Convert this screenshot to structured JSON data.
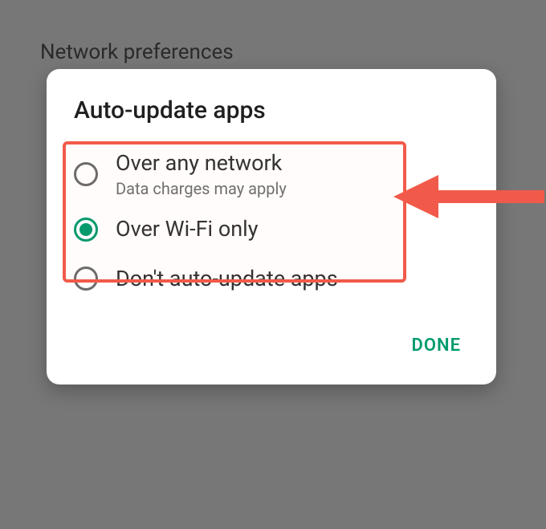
{
  "background": {
    "header": "Network preferences"
  },
  "dialog": {
    "title": "Auto-update apps",
    "options": [
      {
        "label": "Over any network",
        "sub": "Data charges may apply",
        "selected": false
      },
      {
        "label": "Over Wi-Fi only",
        "sub": "",
        "selected": true
      },
      {
        "label": "Don't auto-update apps",
        "sub": "",
        "selected": false
      }
    ],
    "done": "DONE"
  },
  "annotation": {
    "highlight_color": "#f15a4a",
    "accent_color": "#009b6e"
  }
}
